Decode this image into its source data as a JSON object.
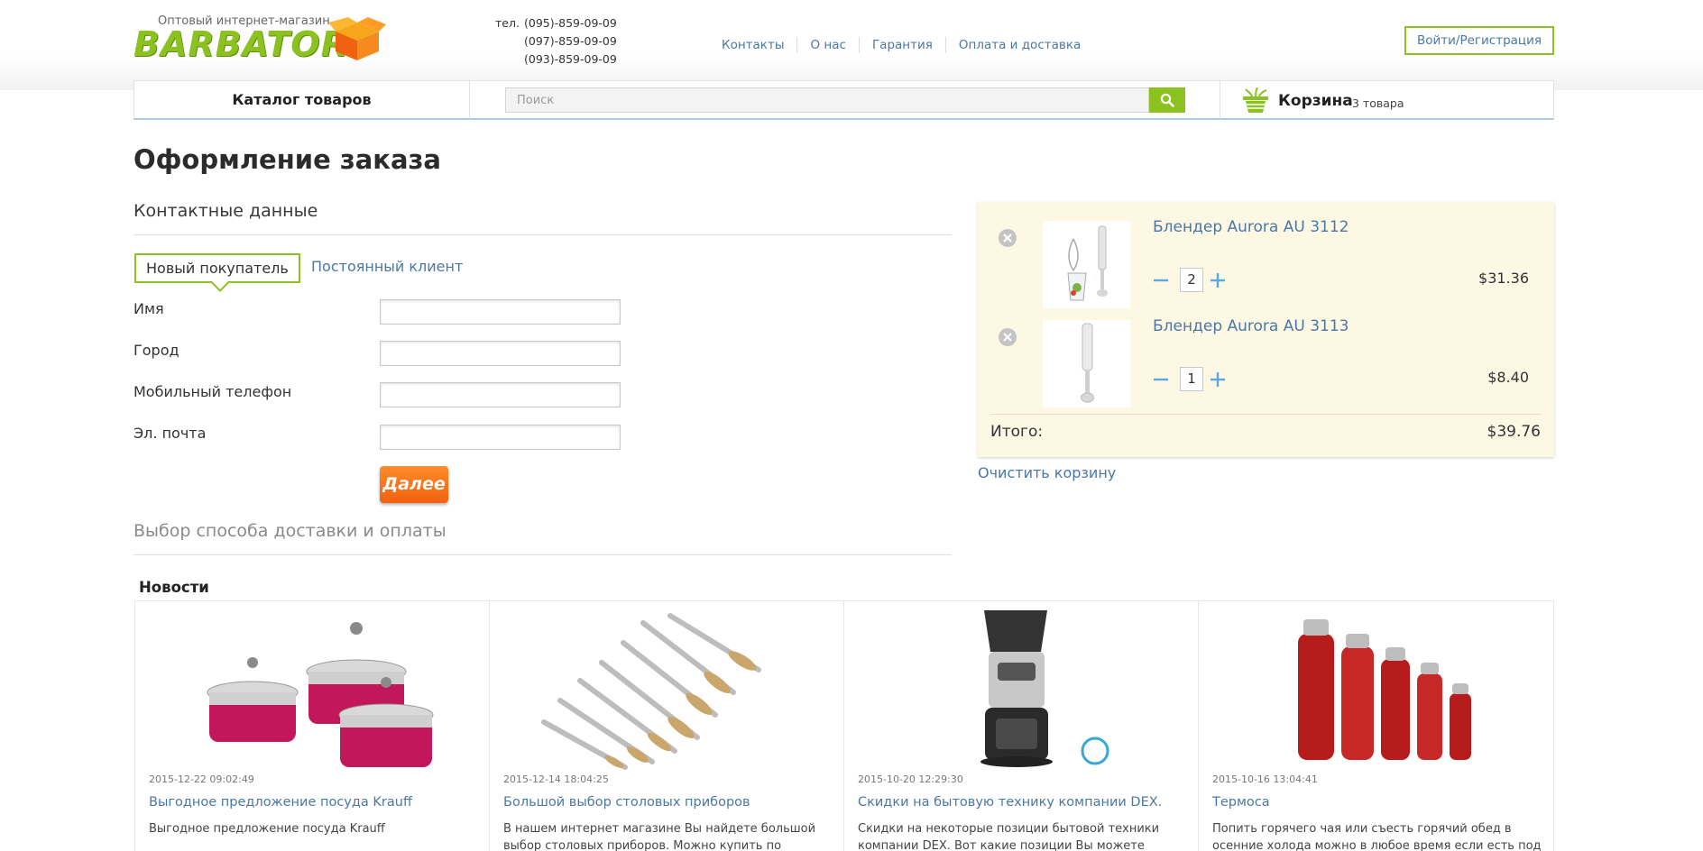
{
  "header": {
    "logo_tagline": "Оптовый интернет-магазин",
    "logo_word": "BARBATOR",
    "phone_label": "тел.",
    "phones": [
      "(095)-859-09-09",
      "(097)-859-09-09",
      "(093)-859-09-09"
    ],
    "nav": [
      "Контакты",
      "О нас",
      "Гарантия",
      "Оплата и доставка"
    ],
    "login_label": "Войти/Регистрация"
  },
  "bar": {
    "catalog_label": "Каталог товаров",
    "search_placeholder": "Поиск",
    "cart_label": "Корзина",
    "cart_count": "3 товара"
  },
  "checkout": {
    "title": "Оформление заказа",
    "contact_section": "Контактные данные",
    "tab_new": "Новый покупатель",
    "tab_returning": "Постоянный клиент",
    "fields": [
      {
        "label": "Имя",
        "value": ""
      },
      {
        "label": "Город",
        "value": ""
      },
      {
        "label": "Мобильный телефон",
        "value": ""
      },
      {
        "label": "Эл. почта",
        "value": ""
      }
    ],
    "next_label": "Далее",
    "delivery_section": "Выбор способа доставки и оплаты"
  },
  "cart": {
    "items": [
      {
        "name": "Блендер Aurora AU 3112",
        "qty": "2",
        "price": "$31.36"
      },
      {
        "name": "Блендер Aurora AU 3113",
        "qty": "1",
        "price": "$8.40"
      }
    ],
    "total_label": "Итого:",
    "total_value": "$39.76",
    "clear_label": "Очистить корзину"
  },
  "news": {
    "title": "Новости",
    "items": [
      {
        "date": "2015-12-22 09:02:49",
        "headline": "Выгодное предложение посуда Krauff",
        "text": "Выгодное предложение посуда Krauff"
      },
      {
        "date": "2015-12-14 18:04:25",
        "headline": "Большой выбор столовых приборов",
        "text": "В нашем интернет магазине Вы найдете большой выбор столовых приборов. Можно купить по отдельности, в"
      },
      {
        "date": "2015-10-20 12:29:30",
        "headline": "Скидки на бытовую технику компании DEX.",
        "text": "Скидки на некоторые позиции бытовой техники компании DEX. Вот какие позиции Вы можете"
      },
      {
        "date": "2015-10-16 13:04:41",
        "headline": "Термоса",
        "text": "Попить горячего чая или съесть горячий обед в осенние холода можно в любое время если есть под рукой"
      }
    ]
  },
  "colors": {
    "accent_green": "#8cc21f",
    "link_blue": "#4a78a6",
    "orange_button": "#f0620f",
    "cart_bg": "#fdf8e4"
  }
}
